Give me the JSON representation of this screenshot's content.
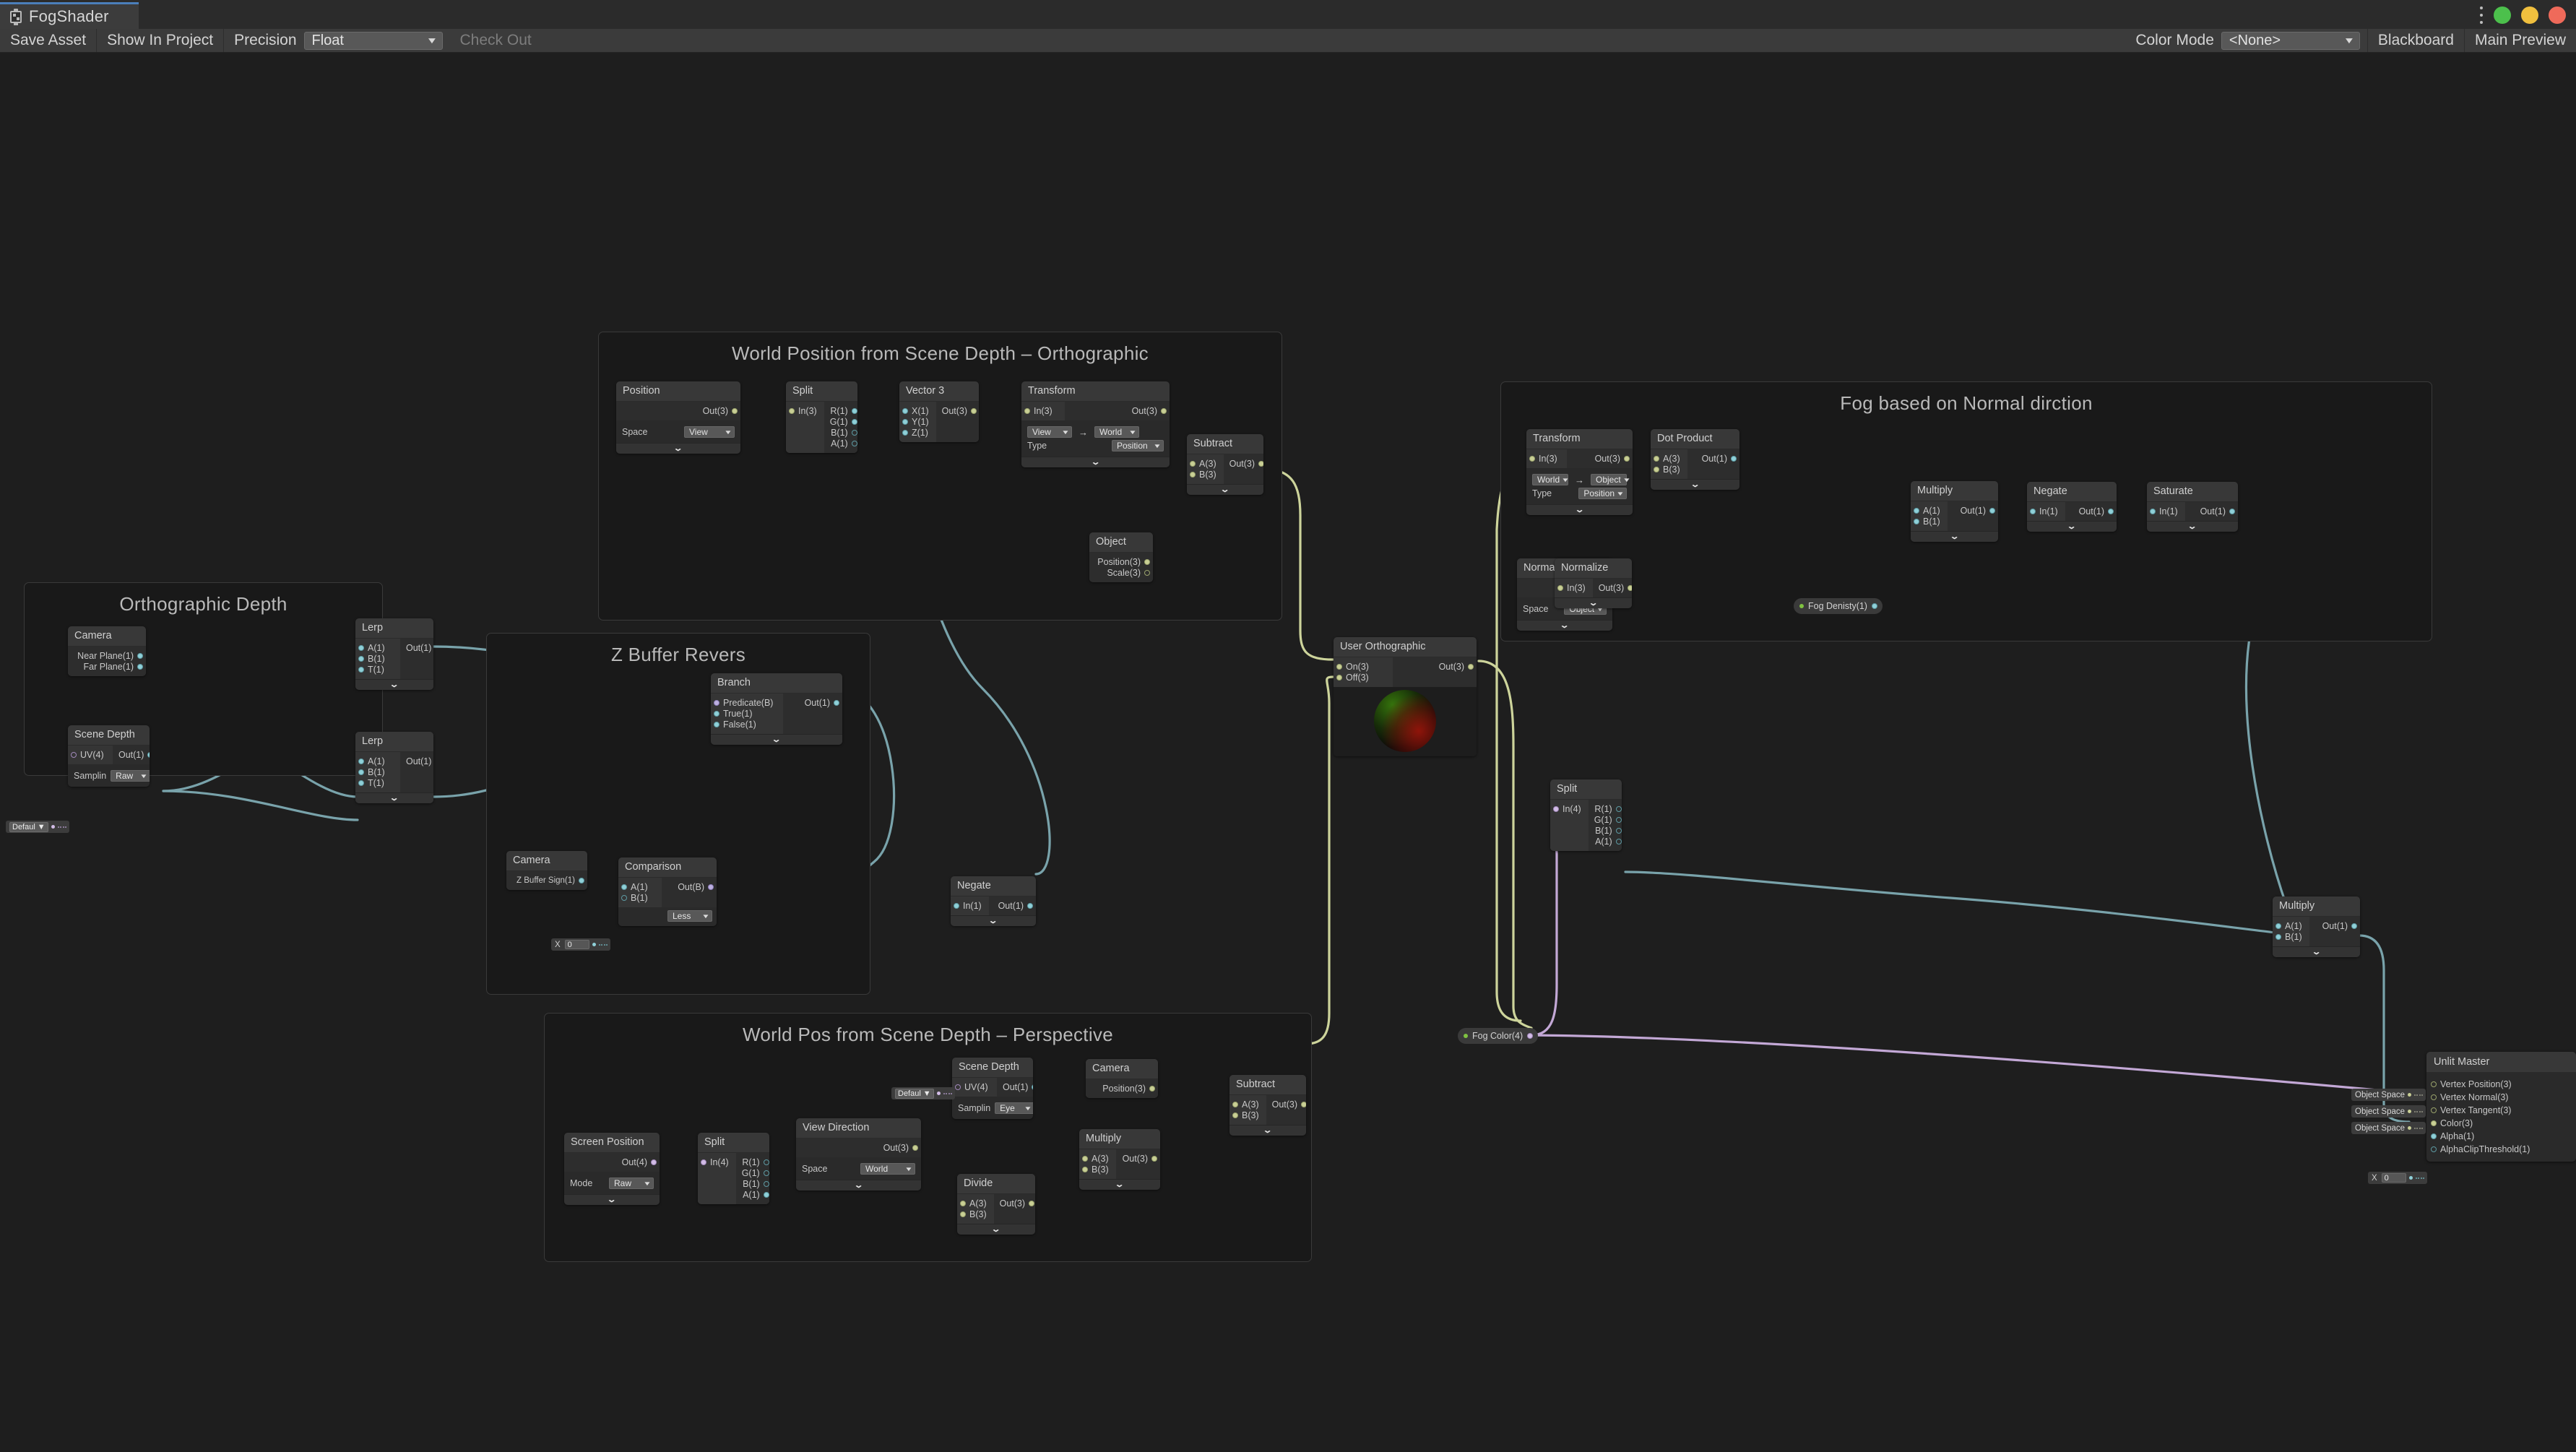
{
  "window": {
    "tab_title": "FogShader",
    "tab_icon": "shader-graph-icon",
    "menu_icon": "kebab-menu-icon",
    "controls": [
      {
        "name": "maximize",
        "color": "#4cc04c"
      },
      {
        "name": "minimize",
        "color": "#f0bf3e"
      },
      {
        "name": "close",
        "color": "#ef6a5a"
      }
    ]
  },
  "toolbar": {
    "save_asset": "Save Asset",
    "show_in_project": "Show In Project",
    "precision_label": "Precision",
    "precision_value": "Float",
    "check_out": "Check Out",
    "color_mode_label": "Color Mode",
    "color_mode_value": "<None>",
    "blackboard": "Blackboard",
    "main_preview": "Main Preview"
  },
  "groups": [
    {
      "id": "ortho_depth",
      "title": "Orthographic Depth"
    },
    {
      "id": "zbuffer",
      "title": "Z Buffer Revers"
    },
    {
      "id": "worldpos_ortho",
      "title": "World Position from Scene Depth – Orthographic"
    },
    {
      "id": "worldpos_persp",
      "title": "World Pos from Scene Depth – Perspective"
    },
    {
      "id": "fog_normal",
      "title": "Fog based on Normal dirction"
    }
  ],
  "nodes": {
    "position": {
      "title": "Position",
      "outputs": [
        {
          "label": "Out(3)",
          "type": "v3"
        }
      ],
      "controls": [
        {
          "label": "Space",
          "value": "View"
        }
      ]
    },
    "split_ortho": {
      "title": "Split",
      "inputs": [
        {
          "label": "In(3)",
          "type": "v3"
        }
      ],
      "outputs": [
        {
          "label": "R(1)",
          "type": "v1",
          "connected": true
        },
        {
          "label": "G(1)",
          "type": "v1",
          "connected": true
        },
        {
          "label": "B(1)",
          "type": "v1",
          "connected": false
        },
        {
          "label": "A(1)",
          "type": "v1",
          "connected": false
        }
      ]
    },
    "vector3": {
      "title": "Vector 3",
      "inputs": [
        {
          "label": "X(1)",
          "type": "v1"
        },
        {
          "label": "Y(1)",
          "type": "v1"
        },
        {
          "label": "Z(1)",
          "type": "v1"
        }
      ],
      "outputs": [
        {
          "label": "Out(3)",
          "type": "v3"
        }
      ]
    },
    "transform_ortho": {
      "title": "Transform",
      "inputs": [
        {
          "label": "In(3)",
          "type": "v3"
        }
      ],
      "outputs": [
        {
          "label": "Out(3)",
          "type": "v3"
        }
      ],
      "from_space": "View",
      "to_space": "World",
      "type_label": "Type",
      "type_value": "Position"
    },
    "object_ortho": {
      "title": "Object",
      "outputs": [
        {
          "label": "Position(3)",
          "type": "v3",
          "connected": true
        },
        {
          "label": "Scale(3)",
          "type": "v3",
          "connected": false
        }
      ]
    },
    "subtract_ortho": {
      "title": "Subtract",
      "inputs": [
        {
          "label": "A(3)",
          "type": "v3"
        },
        {
          "label": "B(3)",
          "type": "v3"
        }
      ],
      "outputs": [
        {
          "label": "Out(3)",
          "type": "v3"
        }
      ]
    },
    "camera_ortho": {
      "title": "Camera",
      "outputs": [
        {
          "label": "Near Plane(1)",
          "type": "v1"
        },
        {
          "label": "Far Plane(1)",
          "type": "v1"
        }
      ]
    },
    "scene_depth_ortho": {
      "title": "Scene Depth",
      "inputs": [
        {
          "label": "UV(4)",
          "type": "v4",
          "connected": false
        }
      ],
      "outputs": [
        {
          "label": "Out(1)",
          "type": "v1"
        }
      ],
      "controls": [
        {
          "label": "Samplin",
          "value": "Raw"
        }
      ]
    },
    "lerp_top": {
      "title": "Lerp",
      "inputs": [
        {
          "label": "A(1)",
          "type": "v1"
        },
        {
          "label": "B(1)",
          "type": "v1"
        },
        {
          "label": "T(1)",
          "type": "v1"
        }
      ],
      "outputs": [
        {
          "label": "Out(1)",
          "type": "v1"
        }
      ]
    },
    "lerp_bottom": {
      "title": "Lerp",
      "inputs": [
        {
          "label": "A(1)",
          "type": "v1"
        },
        {
          "label": "B(1)",
          "type": "v1"
        },
        {
          "label": "T(1)",
          "type": "v1"
        }
      ],
      "outputs": [
        {
          "label": "Out(1)",
          "type": "v1"
        }
      ]
    },
    "branch": {
      "title": "Branch",
      "inputs": [
        {
          "label": "Predicate(B)",
          "type": "bool"
        },
        {
          "label": "True(1)",
          "type": "v1"
        },
        {
          "label": "False(1)",
          "type": "v1"
        }
      ],
      "outputs": [
        {
          "label": "Out(1)",
          "type": "v1"
        }
      ]
    },
    "camera_zbuffer": {
      "title": "Camera",
      "outputs": [
        {
          "label": "Z Buffer Sign(1)",
          "type": "v1"
        }
      ]
    },
    "comparison": {
      "title": "Comparison",
      "inputs": [
        {
          "label": "A(1)",
          "type": "v1"
        },
        {
          "label": "B(1)",
          "type": "v1",
          "connected": false
        }
      ],
      "outputs": [
        {
          "label": "Out(B)",
          "type": "bool"
        }
      ],
      "operator": "Less"
    },
    "comparison_b_value": {
      "x_label": "X",
      "value": "0"
    },
    "negate_zbuffer": {
      "title": "Negate",
      "inputs": [
        {
          "label": "In(1)",
          "type": "v1"
        }
      ],
      "outputs": [
        {
          "label": "Out(1)",
          "type": "v1"
        }
      ]
    },
    "screen_position": {
      "title": "Screen Position",
      "outputs": [
        {
          "label": "Out(4)",
          "type": "v4"
        }
      ],
      "controls": [
        {
          "label": "Mode",
          "value": "Raw"
        }
      ]
    },
    "split_persp": {
      "title": "Split",
      "inputs": [
        {
          "label": "In(4)",
          "type": "v4"
        }
      ],
      "outputs": [
        {
          "label": "R(1)",
          "type": "v1",
          "connected": false
        },
        {
          "label": "G(1)",
          "type": "v1",
          "connected": false
        },
        {
          "label": "B(1)",
          "type": "v1",
          "connected": false
        },
        {
          "label": "A(1)",
          "type": "v1",
          "connected": true
        }
      ]
    },
    "view_direction": {
      "title": "View Direction",
      "outputs": [
        {
          "label": "Out(3)",
          "type": "v3"
        }
      ],
      "controls": [
        {
          "label": "Space",
          "value": "World"
        }
      ]
    },
    "divide_persp": {
      "title": "Divide",
      "inputs": [
        {
          "label": "A(3)",
          "type": "v3"
        },
        {
          "label": "B(3)",
          "type": "v3"
        }
      ],
      "outputs": [
        {
          "label": "Out(3)",
          "type": "v3"
        }
      ]
    },
    "scene_depth_persp": {
      "title": "Scene Depth",
      "inputs": [
        {
          "label": "UV(4)",
          "type": "v4",
          "connected": false
        }
      ],
      "outputs": [
        {
          "label": "Out(1)",
          "type": "v1"
        }
      ],
      "controls": [
        {
          "label": "Samplin",
          "value": "Eye"
        }
      ]
    },
    "multiply_persp": {
      "title": "Multiply",
      "inputs": [
        {
          "label": "A(3)",
          "type": "v3"
        },
        {
          "label": "B(3)",
          "type": "v3"
        }
      ],
      "outputs": [
        {
          "label": "Out(3)",
          "type": "v3"
        }
      ]
    },
    "camera_persp": {
      "title": "Camera",
      "outputs": [
        {
          "label": "Position(3)",
          "type": "v3"
        }
      ]
    },
    "subtract_persp": {
      "title": "Subtract",
      "inputs": [
        {
          "label": "A(3)",
          "type": "v3"
        },
        {
          "label": "B(3)",
          "type": "v3"
        }
      ],
      "outputs": [
        {
          "label": "Out(3)",
          "type": "v3"
        }
      ]
    },
    "user_orthographic": {
      "title": "User Orthographic",
      "inputs": [
        {
          "label": "On(3)",
          "type": "v3"
        },
        {
          "label": "Off(3)",
          "type": "v3"
        }
      ],
      "outputs": [
        {
          "label": "Out(3)",
          "type": "v3"
        }
      ],
      "preview": "sphere-preview"
    },
    "transform_fog": {
      "title": "Transform",
      "inputs": [
        {
          "label": "In(3)",
          "type": "v3"
        }
      ],
      "outputs": [
        {
          "label": "Out(3)",
          "type": "v3"
        }
      ],
      "from_space": "World",
      "to_space": "Object",
      "type_label": "Type",
      "type_value": "Position"
    },
    "normal_vector": {
      "title": "Normal Vector",
      "outputs": [
        {
          "label": "Out(3)",
          "type": "v3"
        }
      ],
      "controls": [
        {
          "label": "Space",
          "value": "Object"
        }
      ]
    },
    "normalize": {
      "title": "Normalize",
      "inputs": [
        {
          "label": "In(3)",
          "type": "v3"
        }
      ],
      "outputs": [
        {
          "label": "Out(3)",
          "type": "v3"
        }
      ]
    },
    "dot_product": {
      "title": "Dot Product",
      "inputs": [
        {
          "label": "A(3)",
          "type": "v3"
        },
        {
          "label": "B(3)",
          "type": "v3"
        }
      ],
      "outputs": [
        {
          "label": "Out(1)",
          "type": "v1"
        }
      ]
    },
    "multiply_fog": {
      "title": "Multiply",
      "inputs": [
        {
          "label": "A(1)",
          "type": "v1"
        },
        {
          "label": "B(1)",
          "type": "v1"
        }
      ],
      "outputs": [
        {
          "label": "Out(1)",
          "type": "v1"
        }
      ]
    },
    "negate_fog": {
      "title": "Negate",
      "inputs": [
        {
          "label": "In(1)",
          "type": "v1"
        }
      ],
      "outputs": [
        {
          "label": "Out(1)",
          "type": "v1"
        }
      ]
    },
    "saturate": {
      "title": "Saturate",
      "inputs": [
        {
          "label": "In(1)",
          "type": "v1"
        }
      ],
      "outputs": [
        {
          "label": "Out(1)",
          "type": "v1"
        }
      ]
    },
    "split_fog": {
      "title": "Split",
      "inputs": [
        {
          "label": "In(4)",
          "type": "v4"
        }
      ],
      "outputs": [
        {
          "label": "R(1)",
          "type": "v1",
          "connected": false
        },
        {
          "label": "G(1)",
          "type": "v1",
          "connected": false
        },
        {
          "label": "B(1)",
          "type": "v1",
          "connected": false
        },
        {
          "label": "A(1)",
          "type": "v1",
          "connected": false
        }
      ]
    },
    "multiply_final": {
      "title": "Multiply",
      "inputs": [
        {
          "label": "A(1)",
          "type": "v1"
        },
        {
          "label": "B(1)",
          "type": "v1"
        }
      ],
      "outputs": [
        {
          "label": "Out(1)",
          "type": "v1"
        }
      ]
    },
    "unlit_master": {
      "title": "Unlit Master",
      "inputs": [
        {
          "label": "Vertex Position(3)",
          "type": "v3",
          "connected": false
        },
        {
          "label": "Vertex Normal(3)",
          "type": "v3",
          "connected": false
        },
        {
          "label": "Vertex Tangent(3)",
          "type": "v3",
          "connected": false
        },
        {
          "label": "Color(3)",
          "type": "v3",
          "connected": true
        },
        {
          "label": "Alpha(1)",
          "type": "v1",
          "connected": true
        },
        {
          "label": "AlphaClipThreshold(1)",
          "type": "v1",
          "connected": false
        }
      ]
    }
  },
  "properties": {
    "fog_density": {
      "label": "Fog Denisty(1)",
      "type": "v1"
    },
    "fog_color": {
      "label": "Fog Color(4)",
      "type": "v4"
    }
  },
  "inline_widgets": {
    "sampler_default_ortho": "Defaul",
    "sampler_default_persp": "Defaul",
    "master_vertex_position": "Object Space",
    "master_vertex_normal": "Object Space",
    "master_vertex_tangent": "Object Space",
    "master_alpha_clip": {
      "x_label": "X",
      "value": "0"
    }
  },
  "colors": {
    "canvas_bg": "#1e1e1e",
    "group_bg": "#191919",
    "node_header": "#383838",
    "edge_v3": "#cdd49b",
    "edge_v1": "#79a3ab",
    "edge_v4": "#c3a8d6",
    "edge_bool": "#9f91c4",
    "accent_tab": "#4b7fbb"
  }
}
